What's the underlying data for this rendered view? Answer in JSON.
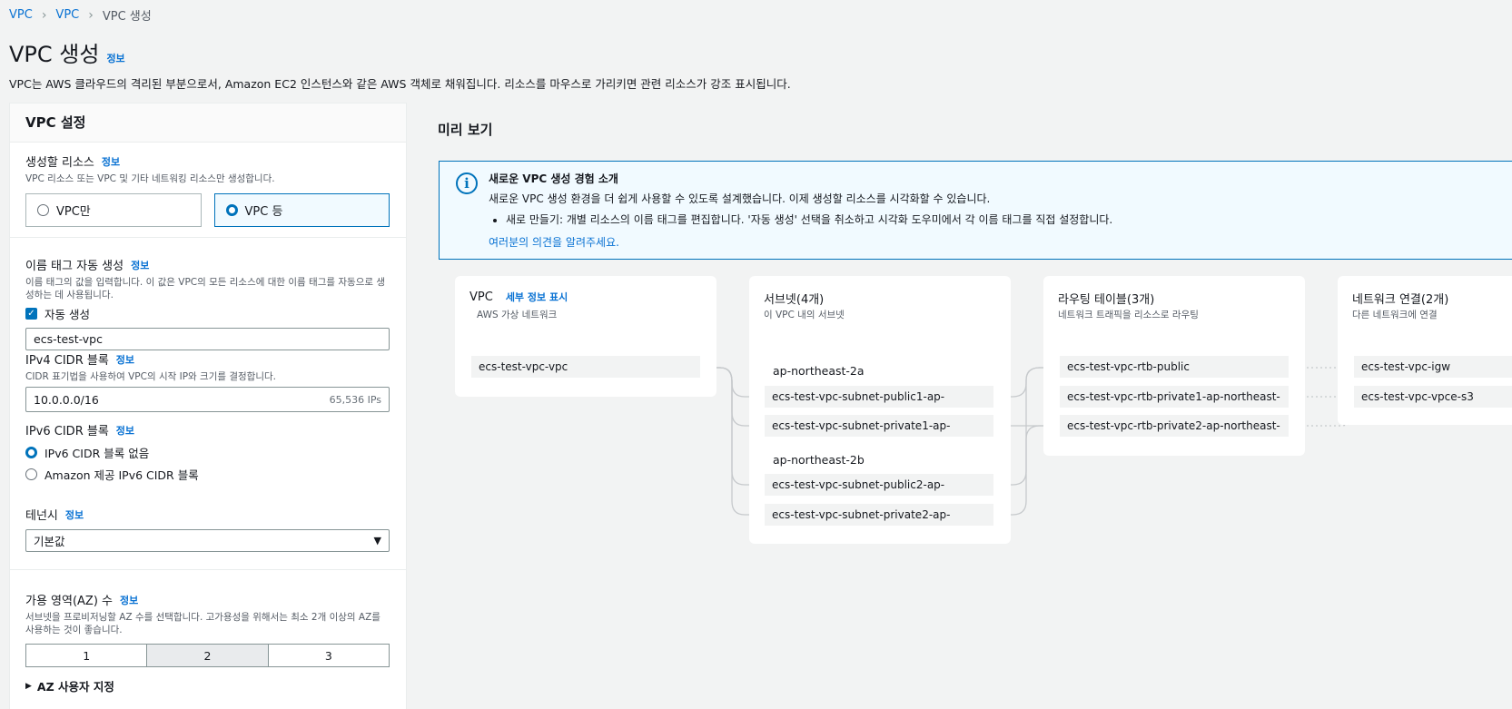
{
  "breadcrumb": {
    "items": [
      "VPC",
      "VPC"
    ],
    "current": "VPC 생성"
  },
  "page": {
    "title": "VPC 생성",
    "info": "정보",
    "description": "VPC는 AWS 클라우드의 격리된 부분으로서, Amazon EC2 인스턴스와 같은 AWS 객체로 채워집니다. 리소스를 마우스로 가리키면 관련 리소스가 강조 표시됩니다."
  },
  "settings": {
    "header": "VPC 설정",
    "resources": {
      "label": "생성할 리소스",
      "info": "정보",
      "desc": "VPC 리소스 또는 VPC 및 기타 네트워킹 리소스만 생성합니다.",
      "options": [
        "VPC만",
        "VPC 등"
      ],
      "selected": "VPC 등"
    },
    "name_tag": {
      "label": "이름 태그 자동 생성",
      "info": "정보",
      "desc": "이름 태그의 값을 입력합니다. 이 값은 VPC의 모든 리소스에 대한 이름 태그를 자동으로 생성하는 데 사용됩니다.",
      "checkbox_label": "자동 생성",
      "checked": true,
      "value": "ecs-test-vpc"
    },
    "ipv4": {
      "label": "IPv4 CIDR 블록",
      "info": "정보",
      "desc": "CIDR 표기법을 사용하여 VPC의 시작 IP와 크기를 결정합니다.",
      "value": "10.0.0.0/16",
      "suffix": "65,536 IPs"
    },
    "ipv6": {
      "label": "IPv6 CIDR 블록",
      "info": "정보",
      "options": [
        "IPv6 CIDR 블록 없음",
        "Amazon 제공 IPv6 CIDR 블록"
      ],
      "selected": "IPv6 CIDR 블록 없음"
    },
    "tenancy": {
      "label": "테넌시",
      "info": "정보",
      "value": "기본값"
    },
    "az": {
      "label": "가용 영역(AZ) 수",
      "info": "정보",
      "desc": "서브넷을 프로비저닝할 AZ 수를 선택합니다. 고가용성을 위해서는 최소 2개 이상의 AZ를 사용하는 것이 좋습니다.",
      "options": [
        "1",
        "2",
        "3"
      ],
      "selected": "2",
      "custom": "AZ 사용자 지정"
    }
  },
  "preview": {
    "title": "미리 보기",
    "notice": {
      "title": "새로운 VPC 생성 경험 소개",
      "body": "새로운 VPC 생성 환경을 더 쉽게 사용할 수 있도록 설계했습니다. 이제 생성할 리소스를 시각화할 수 있습니다.",
      "bullet": "새로 만들기: 개별 리소스의 이름 태그를 편집합니다. '자동 생성' 선택을 취소하고 시각화 도우미에서 각 이름 태그를 직접 설정합니다.",
      "feedback": "여러분의 의견을 알려주세요."
    },
    "vpc": {
      "title": "VPC",
      "details_link": "세부 정보 표시",
      "subtitle": "AWS 가상 네트워크",
      "items": [
        "ecs-test-vpc-vpc"
      ]
    },
    "subnets": {
      "title": "서브넷(4개)",
      "subtitle": "이 VPC 내의 서브넷",
      "az1": "ap-northeast-2a",
      "az1_items": [
        "ecs-test-vpc-subnet-public1-ap-",
        "ecs-test-vpc-subnet-private1-ap-"
      ],
      "az2": "ap-northeast-2b",
      "az2_items": [
        "ecs-test-vpc-subnet-public2-ap-",
        "ecs-test-vpc-subnet-private2-ap-"
      ]
    },
    "route_tables": {
      "title": "라우팅 테이블(3개)",
      "subtitle": "네트워크 트래픽을 리소스로 라우팅",
      "items": [
        "ecs-test-vpc-rtb-public",
        "ecs-test-vpc-rtb-private1-ap-northeast-",
        "ecs-test-vpc-rtb-private2-ap-northeast-"
      ]
    },
    "network": {
      "title": "네트워크 연결(2개)",
      "subtitle": "다른 네트워크에 연결",
      "items": [
        "ecs-test-vpc-igw",
        "ecs-test-vpc-vpce-s3"
      ]
    }
  }
}
